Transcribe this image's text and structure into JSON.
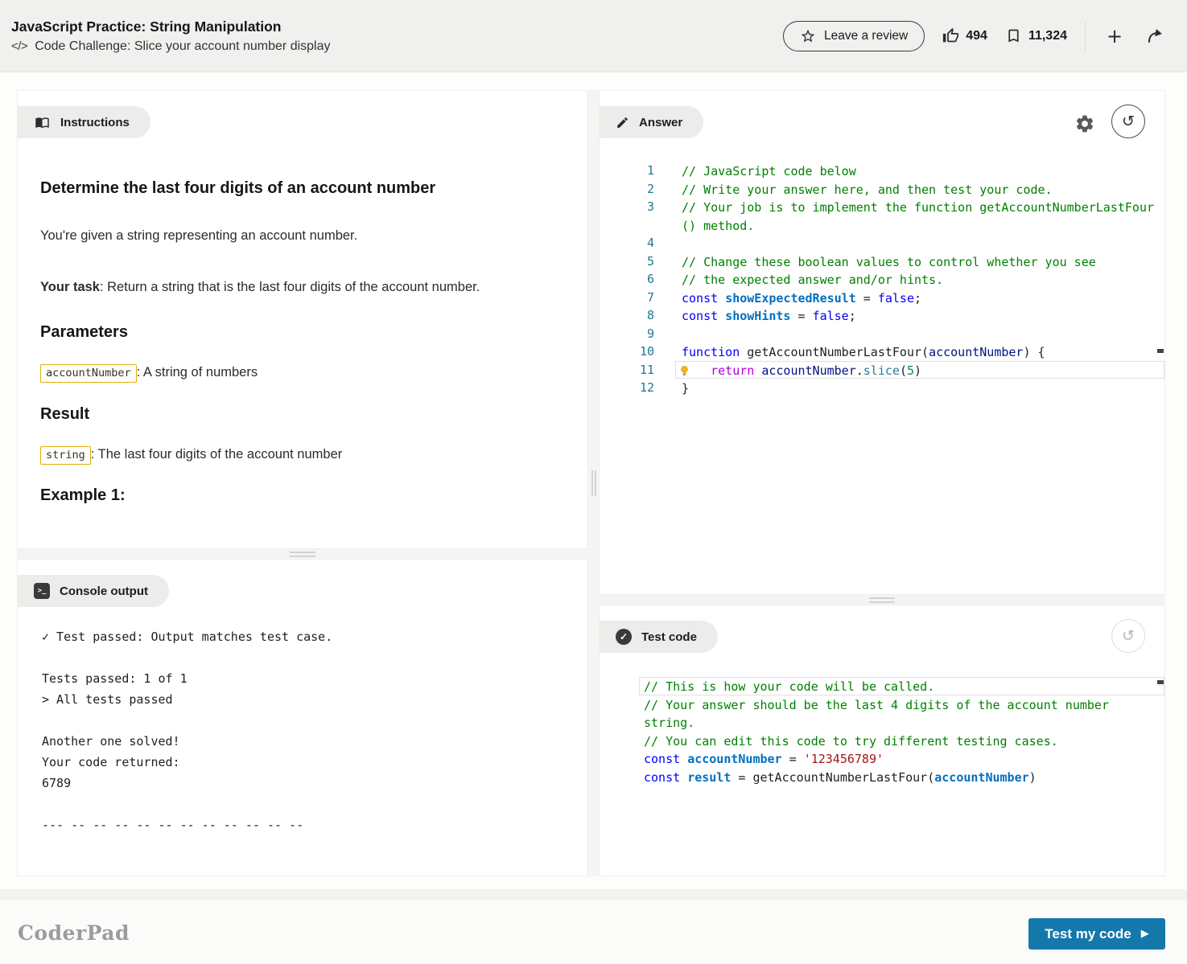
{
  "header": {
    "title": "JavaScript Practice: String Manipulation",
    "subtitle_icon": "</>",
    "subtitle": "Code Challenge: Slice your account number display",
    "review_label": "Leave a review",
    "likes": "494",
    "bookmarks": "11,324",
    "plus": "+"
  },
  "panels": {
    "instructions": {
      "tab": "Instructions",
      "heading": "Determine the last four digits of an account number",
      "p1": "You're given a string representing an account number.",
      "task_label": "Your task",
      "task_text": ": Return a string that is the last four digits of the account number.",
      "parameters_heading": "Parameters",
      "param_code": "accountNumber",
      "param_desc": ": A string of numbers",
      "result_heading": "Result",
      "result_code": "string",
      "result_desc": ": The last four digits of the account number",
      "example_heading": "Example 1:"
    },
    "console": {
      "tab": "Console output",
      "lines": [
        "✓ Test passed: Output matches test case.",
        "",
        "Tests passed: 1 of 1",
        "> All tests passed",
        "",
        "Another one solved!",
        "Your code returned:",
        "6789",
        "",
        "--- -- -- -- -- -- -- -- -- -- -- --"
      ]
    },
    "answer": {
      "tab": "Answer",
      "lines": [
        {
          "n": "1",
          "tokens": [
            {
              "t": "// JavaScript code below",
              "c": "cmt"
            }
          ]
        },
        {
          "n": "2",
          "tokens": [
            {
              "t": "// Write your answer here, and then test your code.",
              "c": "cmt"
            }
          ]
        },
        {
          "n": "3",
          "tokens": [
            {
              "t": "// Your job is to implement the function getAccountNumberLastFour",
              "c": "cmt"
            }
          ]
        },
        {
          "n": "",
          "tokens": [
            {
              "t": "() method.",
              "c": "cmt"
            }
          ]
        },
        {
          "n": "4",
          "tokens": []
        },
        {
          "n": "5",
          "tokens": [
            {
              "t": "// Change these boolean values to control whether you see",
              "c": "cmt"
            }
          ]
        },
        {
          "n": "6",
          "tokens": [
            {
              "t": "// the expected answer and/or hints.",
              "c": "cmt"
            }
          ]
        },
        {
          "n": "7",
          "tokens": [
            {
              "t": "const",
              "c": "kw"
            },
            {
              "t": " ",
              "c": "plain"
            },
            {
              "t": "showExpectedResult",
              "c": "def"
            },
            {
              "t": " = ",
              "c": "plain"
            },
            {
              "t": "false",
              "c": "kw"
            },
            {
              "t": ";",
              "c": "plain"
            }
          ]
        },
        {
          "n": "8",
          "tokens": [
            {
              "t": "const",
              "c": "kw"
            },
            {
              "t": " ",
              "c": "plain"
            },
            {
              "t": "showHints",
              "c": "def"
            },
            {
              "t": " = ",
              "c": "plain"
            },
            {
              "t": "false",
              "c": "kw"
            },
            {
              "t": ";",
              "c": "plain"
            }
          ]
        },
        {
          "n": "9",
          "tokens": []
        },
        {
          "n": "10",
          "tokens": [
            {
              "t": "function",
              "c": "kw"
            },
            {
              "t": " getAccountNumberLastFour(",
              "c": "plain"
            },
            {
              "t": "accountNumber",
              "c": "var"
            },
            {
              "t": ") {",
              "c": "plain"
            }
          ]
        },
        {
          "n": "11",
          "current": true,
          "bulb": true,
          "tokens": [
            {
              "t": "    ",
              "c": "plain"
            },
            {
              "t": "return",
              "c": "ret"
            },
            {
              "t": " ",
              "c": "plain"
            },
            {
              "t": "accountNumber",
              "c": "var"
            },
            {
              "t": ".",
              "c": "plain"
            },
            {
              "t": "slice",
              "c": "meth"
            },
            {
              "t": "(",
              "c": "plain"
            },
            {
              "t": "5",
              "c": "num"
            },
            {
              "t": ")",
              "c": "plain"
            }
          ]
        },
        {
          "n": "12",
          "tokens": [
            {
              "t": "}",
              "c": "plain"
            }
          ]
        }
      ]
    },
    "test": {
      "tab": "Test code",
      "lines": [
        {
          "current": true,
          "tokens": [
            {
              "t": "// This is how your code will be called.",
              "c": "cmt"
            }
          ]
        },
        {
          "tokens": [
            {
              "t": "// Your answer should be the last 4 digits of the account number",
              "c": "cmt"
            }
          ]
        },
        {
          "tokens": [
            {
              "t": "string.",
              "c": "cmt"
            }
          ]
        },
        {
          "tokens": [
            {
              "t": "// You can edit this code to try different testing cases.",
              "c": "cmt"
            }
          ]
        },
        {
          "tokens": [
            {
              "t": "const",
              "c": "kw"
            },
            {
              "t": " ",
              "c": "plain"
            },
            {
              "t": "accountNumber",
              "c": "def"
            },
            {
              "t": " = ",
              "c": "plain"
            },
            {
              "t": "'123456789'",
              "c": "str"
            }
          ]
        },
        {
          "tokens": [
            {
              "t": "const",
              "c": "kw"
            },
            {
              "t": " ",
              "c": "plain"
            },
            {
              "t": "result",
              "c": "def"
            },
            {
              "t": " = ",
              "c": "plain"
            },
            {
              "t": "getAccountNumberLastFour(",
              "c": "plain"
            },
            {
              "t": "accountNumber",
              "c": "def"
            },
            {
              "t": ")",
              "c": "plain"
            }
          ]
        }
      ]
    }
  },
  "footer": {
    "logo": "CoderPad",
    "run_label": "Test my code",
    "run_icon": "▶"
  },
  "colors": {
    "accent_blue": "#1578ab",
    "chip_border": "#e0b10e",
    "comment_green": "#008000",
    "keyword_blue": "#0000ff"
  }
}
